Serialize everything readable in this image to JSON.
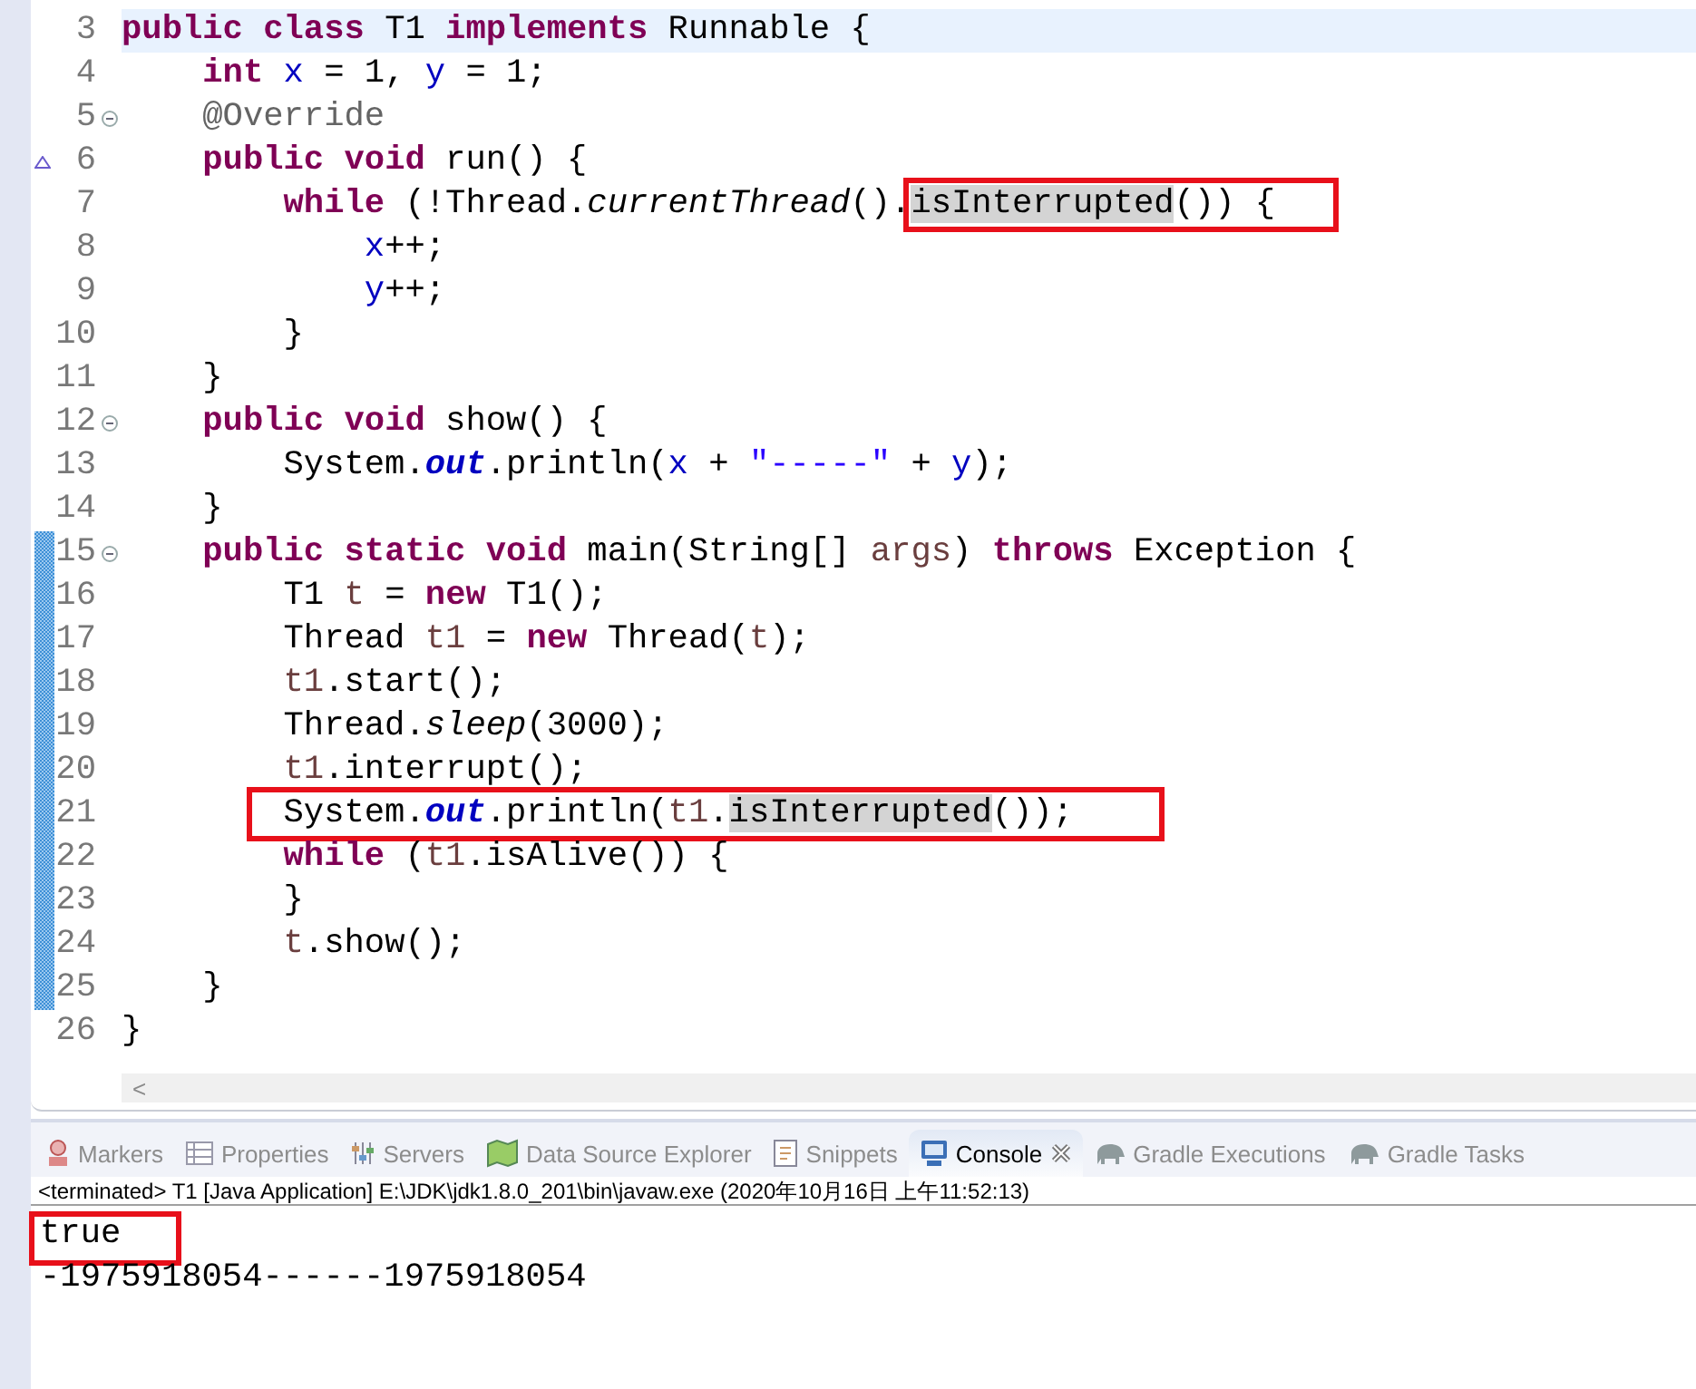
{
  "editor": {
    "lines": [
      {
        "number": "3",
        "current": true,
        "changed": false,
        "foldable": false,
        "overrides": false,
        "tokens": [
          {
            "text": "public",
            "kind": "keyword"
          },
          {
            "text": " class",
            "kind": "keyword"
          },
          {
            "text": " T1 ",
            "kind": "plain"
          },
          {
            "text": "implements",
            "kind": "keyword"
          },
          {
            "text": " Runnable {",
            "kind": "plain"
          }
        ]
      },
      {
        "number": "4",
        "current": false,
        "changed": false,
        "foldable": false,
        "overrides": false,
        "tokens": [
          {
            "text": "    int",
            "kind": "keyword"
          },
          {
            "text": " x",
            "kind": "field"
          },
          {
            "text": " = 1, ",
            "kind": "plain"
          },
          {
            "text": "y",
            "kind": "field"
          },
          {
            "text": " = 1;",
            "kind": "plain"
          }
        ]
      },
      {
        "number": "5",
        "current": false,
        "changed": false,
        "foldable": true,
        "overrides": false,
        "tokens": [
          {
            "text": "    @Override",
            "kind": "annotation"
          }
        ]
      },
      {
        "number": "6",
        "current": false,
        "changed": false,
        "foldable": false,
        "overrides": true,
        "tokens": [
          {
            "text": "    public",
            "kind": "keyword"
          },
          {
            "text": " void",
            "kind": "keyword"
          },
          {
            "text": " run() {",
            "kind": "plain"
          }
        ]
      },
      {
        "number": "7",
        "current": false,
        "changed": false,
        "foldable": false,
        "overrides": false,
        "tokens": [
          {
            "text": "        while",
            "kind": "keyword"
          },
          {
            "text": " (!Thread.",
            "kind": "plain"
          },
          {
            "text": "currentThread",
            "kind": "static_method"
          },
          {
            "text": "().",
            "kind": "plain"
          }
        ],
        "boxed_tokens": [
          {
            "text": "isInterrupted",
            "kind": "occurrence"
          },
          {
            "text": "()) {",
            "kind": "plain"
          }
        ]
      },
      {
        "number": "8",
        "current": false,
        "changed": false,
        "foldable": false,
        "overrides": false,
        "tokens": [
          {
            "text": "            x",
            "kind": "field"
          },
          {
            "text": "++;",
            "kind": "plain"
          }
        ]
      },
      {
        "number": "9",
        "current": false,
        "changed": false,
        "foldable": false,
        "overrides": false,
        "tokens": [
          {
            "text": "            y",
            "kind": "field"
          },
          {
            "text": "++;",
            "kind": "plain"
          }
        ]
      },
      {
        "number": "10",
        "current": false,
        "changed": false,
        "foldable": false,
        "overrides": false,
        "tokens": [
          {
            "text": "        }",
            "kind": "plain"
          }
        ]
      },
      {
        "number": "11",
        "current": false,
        "changed": false,
        "foldable": false,
        "overrides": false,
        "tokens": [
          {
            "text": "    }",
            "kind": "plain"
          }
        ]
      },
      {
        "number": "12",
        "current": false,
        "changed": false,
        "foldable": true,
        "overrides": false,
        "tokens": [
          {
            "text": "    public",
            "kind": "keyword"
          },
          {
            "text": " void",
            "kind": "keyword"
          },
          {
            "text": " show() {",
            "kind": "plain"
          }
        ]
      },
      {
        "number": "13",
        "current": false,
        "changed": false,
        "foldable": false,
        "overrides": false,
        "tokens": [
          {
            "text": "        System.",
            "kind": "plain"
          },
          {
            "text": "out",
            "kind": "static_field"
          },
          {
            "text": ".println(",
            "kind": "plain"
          },
          {
            "text": "x",
            "kind": "field"
          },
          {
            "text": " + ",
            "kind": "plain"
          },
          {
            "text": "\"-----\"",
            "kind": "string"
          },
          {
            "text": " + ",
            "kind": "plain"
          },
          {
            "text": "y",
            "kind": "field"
          },
          {
            "text": ");",
            "kind": "plain"
          }
        ]
      },
      {
        "number": "14",
        "current": false,
        "changed": false,
        "foldable": false,
        "overrides": false,
        "tokens": [
          {
            "text": "    }",
            "kind": "plain"
          }
        ]
      },
      {
        "number": "15",
        "current": false,
        "changed": true,
        "foldable": true,
        "overrides": false,
        "tokens": [
          {
            "text": "    public",
            "kind": "keyword"
          },
          {
            "text": " static",
            "kind": "keyword"
          },
          {
            "text": " void",
            "kind": "keyword"
          },
          {
            "text": " main(String[] ",
            "kind": "plain"
          },
          {
            "text": "args",
            "kind": "local"
          },
          {
            "text": ") ",
            "kind": "plain"
          },
          {
            "text": "throws",
            "kind": "keyword"
          },
          {
            "text": " Exception {",
            "kind": "plain"
          }
        ]
      },
      {
        "number": "16",
        "current": false,
        "changed": true,
        "foldable": false,
        "overrides": false,
        "tokens": [
          {
            "text": "        T1 ",
            "kind": "plain"
          },
          {
            "text": "t",
            "kind": "local"
          },
          {
            "text": " = ",
            "kind": "plain"
          },
          {
            "text": "new",
            "kind": "keyword"
          },
          {
            "text": " T1();",
            "kind": "plain"
          }
        ]
      },
      {
        "number": "17",
        "current": false,
        "changed": true,
        "foldable": false,
        "overrides": false,
        "tokens": [
          {
            "text": "        Thread ",
            "kind": "plain"
          },
          {
            "text": "t1",
            "kind": "local"
          },
          {
            "text": " = ",
            "kind": "plain"
          },
          {
            "text": "new",
            "kind": "keyword"
          },
          {
            "text": " Thread(",
            "kind": "plain"
          },
          {
            "text": "t",
            "kind": "local"
          },
          {
            "text": ");",
            "kind": "plain"
          }
        ]
      },
      {
        "number": "18",
        "current": false,
        "changed": true,
        "foldable": false,
        "overrides": false,
        "tokens": [
          {
            "text": "        t1",
            "kind": "local"
          },
          {
            "text": ".start();",
            "kind": "plain"
          }
        ]
      },
      {
        "number": "19",
        "current": false,
        "changed": true,
        "foldable": false,
        "overrides": false,
        "tokens": [
          {
            "text": "        Thread.",
            "kind": "plain"
          },
          {
            "text": "sleep",
            "kind": "static_method"
          },
          {
            "text": "(3000);",
            "kind": "plain"
          }
        ]
      },
      {
        "number": "20",
        "current": false,
        "changed": true,
        "foldable": false,
        "overrides": false,
        "tokens": [
          {
            "text": "        t1",
            "kind": "local"
          },
          {
            "text": ".interrupt();",
            "kind": "plain"
          }
        ]
      },
      {
        "number": "21",
        "current": false,
        "changed": true,
        "foldable": false,
        "overrides": false,
        "boxed_tokens": [
          {
            "text": "        System.",
            "kind": "plain"
          },
          {
            "text": "out",
            "kind": "static_field"
          },
          {
            "text": ".println(",
            "kind": "plain"
          },
          {
            "text": "t1",
            "kind": "local"
          },
          {
            "text": ".",
            "kind": "plain"
          },
          {
            "text": "isInterrupted",
            "kind": "occurrence"
          },
          {
            "text": "());",
            "kind": "plain"
          }
        ]
      },
      {
        "number": "22",
        "current": false,
        "changed": true,
        "foldable": false,
        "overrides": false,
        "tokens": [
          {
            "text": "        while",
            "kind": "keyword"
          },
          {
            "text": " (",
            "kind": "plain"
          },
          {
            "text": "t1",
            "kind": "local"
          },
          {
            "text": ".isAlive()) {",
            "kind": "plain"
          }
        ]
      },
      {
        "number": "23",
        "current": false,
        "changed": true,
        "foldable": false,
        "overrides": false,
        "tokens": [
          {
            "text": "        }",
            "kind": "plain"
          }
        ]
      },
      {
        "number": "24",
        "current": false,
        "changed": true,
        "foldable": false,
        "overrides": false,
        "tokens": [
          {
            "text": "        t",
            "kind": "local"
          },
          {
            "text": ".show();",
            "kind": "plain"
          }
        ]
      },
      {
        "number": "25",
        "current": false,
        "changed": true,
        "foldable": false,
        "overrides": false,
        "tokens": [
          {
            "text": "    }",
            "kind": "plain"
          }
        ]
      },
      {
        "number": "26",
        "current": false,
        "changed": false,
        "foldable": false,
        "overrides": false,
        "tokens": [
          {
            "text": "}",
            "kind": "plain"
          }
        ]
      }
    ],
    "scroll_left": "<"
  },
  "views": {
    "tabs": [
      {
        "label": "Markers",
        "selected": false,
        "closable": false
      },
      {
        "label": "Properties",
        "selected": false,
        "closable": false
      },
      {
        "label": "Servers",
        "selected": false,
        "closable": false
      },
      {
        "label": "Data Source Explorer",
        "selected": false,
        "closable": false
      },
      {
        "label": "Snippets",
        "selected": false,
        "closable": false
      },
      {
        "label": "Console",
        "selected": true,
        "closable": true
      },
      {
        "label": "Gradle Executions",
        "selected": false,
        "closable": false
      },
      {
        "label": "Gradle Tasks",
        "selected": false,
        "closable": false
      }
    ]
  },
  "console": {
    "header": "<terminated> T1 [Java Application] E:\\JDK\\jdk1.8.0_201\\bin\\javaw.exe (2020年10月16日 上午11:52:13)",
    "output": [
      {
        "text": "true",
        "boxed": true
      },
      {
        "text": "-1975918054------1975918054",
        "boxed": false
      }
    ]
  }
}
